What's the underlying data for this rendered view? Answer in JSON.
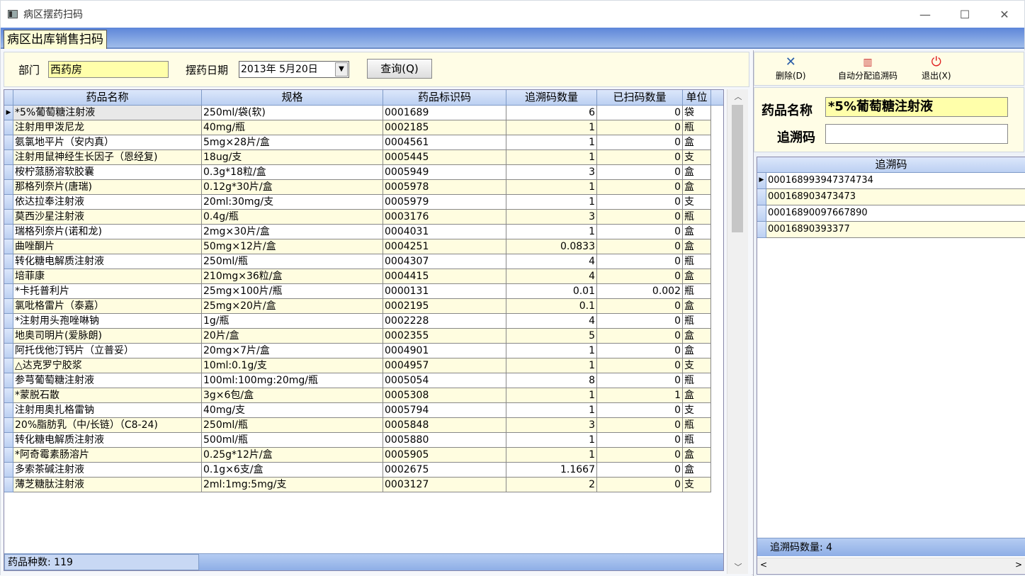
{
  "window": {
    "title": "病区摆药扫码",
    "minimize": "—",
    "maximize": "☐",
    "close": "✕"
  },
  "tab": {
    "label": "病区出库销售扫码"
  },
  "filter": {
    "dept_label": "部门",
    "dept_value": "西药房",
    "date_label": "摆药日期",
    "date_value": "2013年 5月20日",
    "query_button": "查询(Q)"
  },
  "grid": {
    "columns": [
      "药品名称",
      "规格",
      "药品标识码",
      "追溯码数量",
      "已扫码数量",
      "单位"
    ],
    "rows": [
      [
        "*5%葡萄糖注射液",
        "250ml/袋(软)",
        "0001689",
        "6",
        "0",
        "袋"
      ],
      [
        "注射用甲泼尼龙",
        "40mg/瓶",
        "0002185",
        "1",
        "0",
        "瓶"
      ],
      [
        "氨氯地平片（安内真）",
        "5mg×28片/盒",
        "0004561",
        "1",
        "0",
        "盒"
      ],
      [
        "注射用鼠神经生长因子（恩经复)",
        "18ug/支",
        "0005445",
        "1",
        "0",
        "支"
      ],
      [
        "桉柠蒎肠溶软胶囊",
        "0.3g*18粒/盒",
        "0005949",
        "3",
        "0",
        "盒"
      ],
      [
        "那格列奈片(唐瑞)",
        "0.12g*30片/盒",
        "0005978",
        "1",
        "0",
        "盒"
      ],
      [
        "依达拉奉注射液",
        "20ml:30mg/支",
        "0005979",
        "1",
        "0",
        "支"
      ],
      [
        "莫西沙星注射液",
        "0.4g/瓶",
        "0003176",
        "3",
        "0",
        "瓶"
      ],
      [
        "瑞格列奈片(诺和龙)",
        "2mg×30片/盒",
        "0004031",
        "1",
        "0",
        "盒"
      ],
      [
        "曲唑酮片",
        "50mg×12片/盒",
        "0004251",
        "0.0833",
        "0",
        "盒"
      ],
      [
        "转化糖电解质注射液",
        "250ml/瓶",
        "0004307",
        "4",
        "0",
        "瓶"
      ],
      [
        "培菲康",
        "210mg×36粒/盒",
        "0004415",
        "4",
        "0",
        "盒"
      ],
      [
        "*卡托普利片",
        "25mg×100片/瓶",
        "0000131",
        "0.01",
        "0.002",
        "瓶"
      ],
      [
        "氯吡格雷片（泰嘉）",
        "25mg×20片/盒",
        "0002195",
        "0.1",
        "0",
        "盒"
      ],
      [
        "*注射用头孢唑啉钠",
        "1g/瓶",
        "0002228",
        "4",
        "0",
        "瓶"
      ],
      [
        "地奥司明片(爱脉朗)",
        "20片/盒",
        "0002355",
        "5",
        "0",
        "盒"
      ],
      [
        "阿托伐他汀钙片（立普妥）",
        "20mg×7片/盒",
        "0004901",
        "1",
        "0",
        "盒"
      ],
      [
        "△达克罗宁胶浆",
        "10ml:0.1g/支",
        "0004957",
        "1",
        "0",
        "支"
      ],
      [
        "参芎葡萄糖注射液",
        "100ml:100mg:20mg/瓶",
        "0005054",
        "8",
        "0",
        "瓶"
      ],
      [
        "*蒙脱石散",
        "3g×6包/盒",
        "0005308",
        "1",
        "1",
        "盒"
      ],
      [
        "注射用奥扎格雷钠",
        "40mg/支",
        "0005794",
        "1",
        "0",
        "支"
      ],
      [
        "20%脂肪乳（中/长链）（C8-24)",
        "250ml/瓶",
        "0005848",
        "3",
        "0",
        "瓶"
      ],
      [
        "转化糖电解质注射液",
        "500ml/瓶",
        "0005880",
        "1",
        "0",
        "瓶"
      ],
      [
        "*阿奇霉素肠溶片",
        "0.25g*12片/盒",
        "0005905",
        "1",
        "0",
        "盒"
      ],
      [
        "多索茶碱注射液",
        "0.1g×6支/盒",
        "0002675",
        "1.1667",
        "0",
        "盒"
      ],
      [
        "薄芝糖肽注射液",
        "2ml:1mg:5mg/支",
        "0003127",
        "2",
        "0",
        "支"
      ]
    ],
    "footer": "药品种数: 119"
  },
  "toolbar": {
    "delete": "删除(D)",
    "auto": "自动分配追溯码",
    "exit": "退出(X)"
  },
  "info": {
    "name_label": "药品名称",
    "name_value": "*5%葡萄糖注射液",
    "trace_label": "追溯码",
    "trace_value": ""
  },
  "trace_grid": {
    "header": "追溯码",
    "rows": [
      "000168993947374734",
      "000168903473473",
      "00016890097667890",
      "00016890393377"
    ],
    "footer": "追溯码数量: 4"
  },
  "colors": {
    "row_alt": "#fffde0",
    "yellow_field": "#ffffaa",
    "header_blue": "#bcd0f2"
  }
}
